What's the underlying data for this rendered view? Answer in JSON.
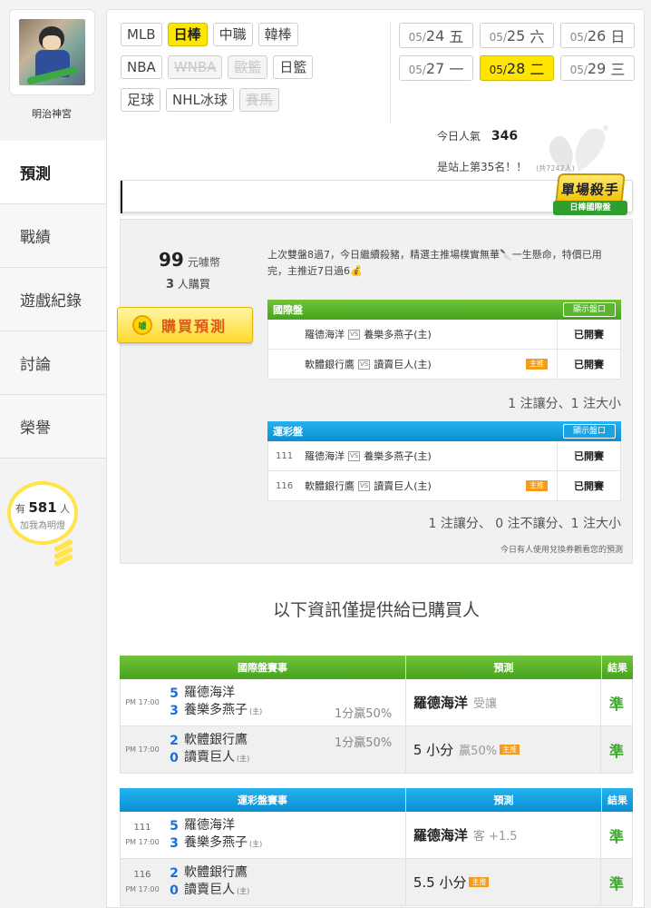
{
  "user": {
    "name": "明治神宮"
  },
  "nav": [
    {
      "label": "預測",
      "active": true
    },
    {
      "label": "戰績",
      "active": false
    },
    {
      "label": "遊戲紀錄",
      "active": false
    },
    {
      "label": "討論",
      "active": false
    },
    {
      "label": "榮譽",
      "active": false
    }
  ],
  "fans": {
    "prefix": "有",
    "count": "581",
    "unit": "人",
    "label": "加我為明燈"
  },
  "sports": [
    [
      {
        "label": "MLB",
        "state": "normal"
      },
      {
        "label": "日棒",
        "state": "active"
      },
      {
        "label": "中職",
        "state": "normal"
      },
      {
        "label": "韓棒",
        "state": "normal"
      }
    ],
    [
      {
        "label": "NBA",
        "state": "normal"
      },
      {
        "label": "WNBA",
        "state": "disabled"
      },
      {
        "label": "歐籃",
        "state": "disabled"
      },
      {
        "label": "日籃",
        "state": "normal"
      }
    ],
    [
      {
        "label": "足球",
        "state": "normal"
      },
      {
        "label": "NHL冰球",
        "state": "normal"
      },
      {
        "label": "賽馬",
        "state": "disabled"
      }
    ]
  ],
  "dates": [
    [
      {
        "md": "05/",
        "day": "24",
        "wd": "五",
        "active": false
      },
      {
        "md": "05/",
        "day": "25",
        "wd": "六",
        "active": false
      },
      {
        "md": "05/",
        "day": "26",
        "wd": "日",
        "active": false
      }
    ],
    [
      {
        "md": "05/",
        "day": "27",
        "wd": "一",
        "active": false
      },
      {
        "md": "05/",
        "day": "28",
        "wd": "二",
        "active": true
      },
      {
        "md": "05/",
        "day": "29",
        "wd": "三",
        "active": false
      }
    ]
  ],
  "stats": {
    "popularity_label": "今日人氣",
    "popularity_value": "346",
    "rank_text": "是站上第35名！！",
    "rank_note": "(共7242人)"
  },
  "badge": {
    "title": "單場殺手",
    "sub": "日棒國際盤"
  },
  "package": {
    "price_value": "99",
    "price_unit": "元噱幣",
    "buyers_value": "3",
    "buyers_unit": "人購買",
    "buy_label": "購買預測",
    "coin_text": "噱",
    "description": "上次雙盤8過7，今日繼續殺豬，精選主推場樸實無華🔪一生懸命，特價已用完，主推近7日過6💰",
    "international": {
      "title": "國際盤",
      "button": "顯示盤口",
      "rows": [
        {
          "no": "",
          "away": "羅德海洋",
          "vs": "VS",
          "home": "養樂多燕子(主)",
          "main": "",
          "state": "已開賽"
        },
        {
          "no": "",
          "away": "軟體銀行鷹",
          "vs": "VS",
          "home": "讀賣巨人(主)",
          "main": "主推",
          "state": "已開賽"
        }
      ],
      "summary": "1 注讓分、1 注大小"
    },
    "lottery": {
      "title": "運彩盤",
      "button": "顯示盤口",
      "rows": [
        {
          "no": "111",
          "away": "羅德海洋",
          "vs": "VS",
          "home": "養樂多燕子(主)",
          "main": "",
          "state": "已開賽"
        },
        {
          "no": "116",
          "away": "軟體銀行鷹",
          "vs": "VS",
          "home": "讀賣巨人(主)",
          "main": "主推",
          "state": "已開賽"
        }
      ],
      "summary": "1 注讓分、 0 注不讓分、1 注大小"
    },
    "note": "今日有人使用兌換券觀看您的預測"
  },
  "only_buyers": "以下資訊僅提供給已購買人",
  "intl_table": {
    "headers": [
      "國際盤賽事",
      "預測",
      "結果"
    ],
    "rows": [
      {
        "no": "",
        "time": "PM 17:00",
        "s1": "5",
        "s2": "3",
        "t1": "羅德海洋",
        "t2": "養樂多燕子",
        "home": "(主)",
        "spread": "1分贏50%",
        "spread_row": 2,
        "pick": "羅德海洋",
        "pick_sub": "受讓",
        "main": "",
        "result": "準"
      },
      {
        "no": "",
        "time": "PM 17:00",
        "s1": "2",
        "s2": "0",
        "t1": "軟體銀行鷹",
        "t2": "讀賣巨人",
        "home": "(主)",
        "spread": "1分贏50%",
        "spread_row": 1,
        "pick": "5 小分",
        "pick_sub": "贏50%",
        "main": "主推",
        "result": "準"
      }
    ]
  },
  "lot_table": {
    "headers": [
      "運彩盤賽事",
      "預測",
      "結果"
    ],
    "rows": [
      {
        "no": "111",
        "time": "PM 17:00",
        "s1": "5",
        "s2": "3",
        "t1": "羅德海洋",
        "t2": "養樂多燕子",
        "home": "(主)",
        "spread": "",
        "spread_row": 0,
        "pick": "羅德海洋",
        "pick_sub": "客 +1.5",
        "main": "",
        "result": "準"
      },
      {
        "no": "116",
        "time": "PM 17:00",
        "s1": "2",
        "s2": "0",
        "t1": "軟體銀行鷹",
        "t2": "讀賣巨人",
        "home": "(主)",
        "spread": "",
        "spread_row": 0,
        "pick": "5.5 小分",
        "pick_sub": "",
        "main": "主推",
        "result": "準"
      }
    ]
  }
}
